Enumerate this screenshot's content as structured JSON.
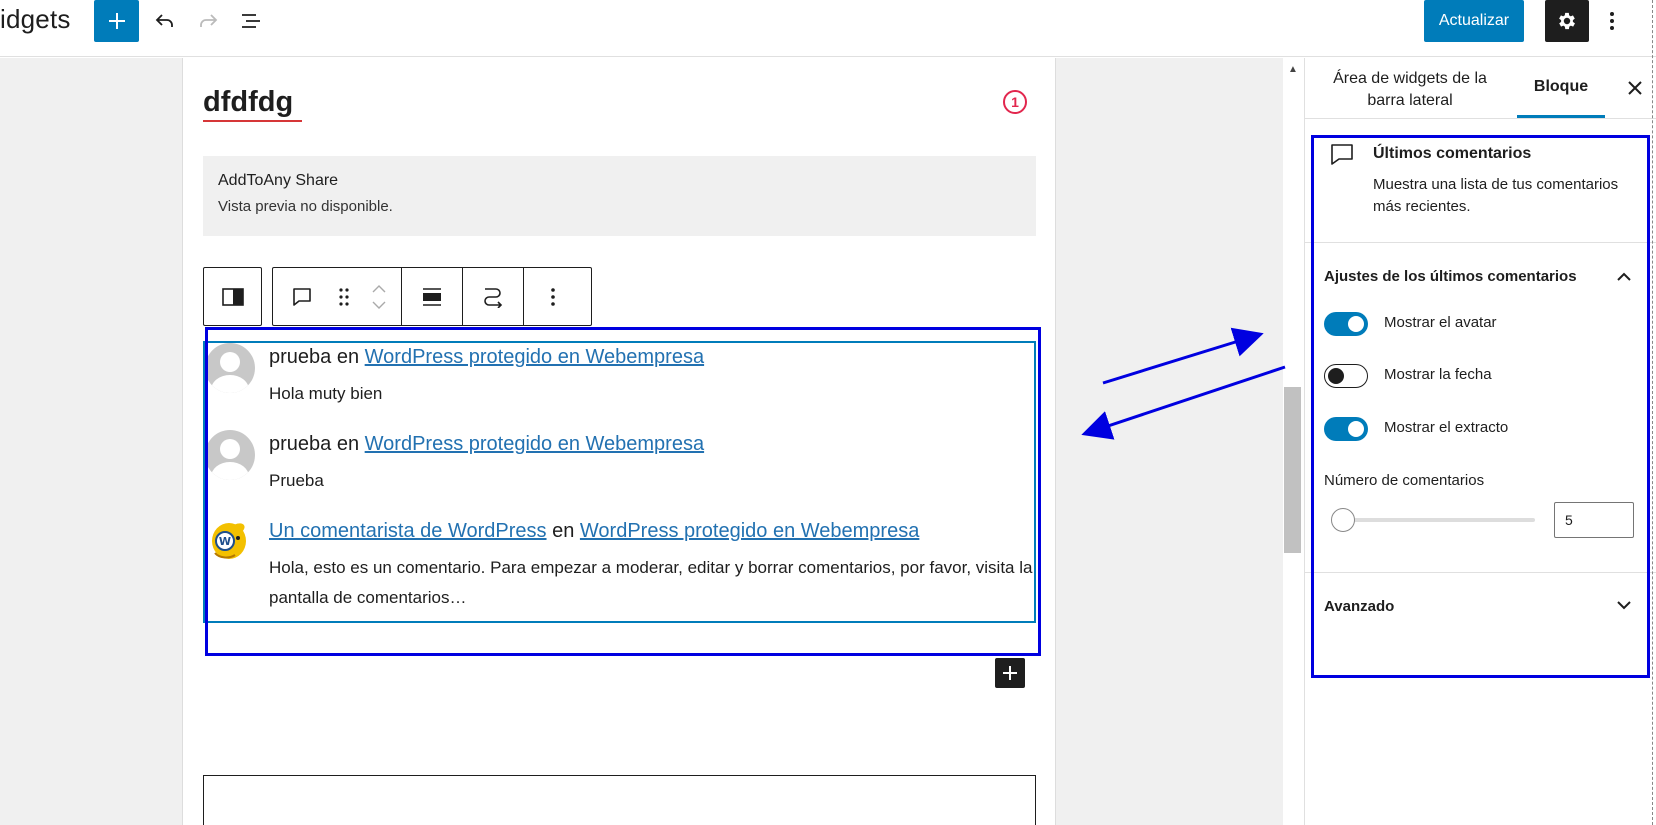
{
  "header": {
    "app_title": "idgets",
    "update_label": "Actualizar"
  },
  "editor": {
    "area_title": "dfdfdg",
    "error_count": "1",
    "share_block": {
      "title": "AddToAny Share",
      "subtitle": "Vista previa no disponible."
    },
    "comments": [
      {
        "author": "prueba",
        "connector": "en",
        "post": "WordPress protegido en Webempresa",
        "excerpt": "Hola muty bien",
        "author_is_link": false
      },
      {
        "author": "prueba",
        "connector": "en",
        "post": "WordPress protegido en Webempresa",
        "excerpt": "Prueba",
        "author_is_link": false
      },
      {
        "author": "Un comentarista de WordPress",
        "connector": "en",
        "post": "WordPress protegido en Webempresa",
        "excerpt": "Hola, esto es un comentario. Para empezar a moderar, editar y borrar comentarios, por favor, visita la pantalla de comentarios…",
        "author_is_link": true
      }
    ]
  },
  "sidebar": {
    "tab_widgets": "Área de widgets de la barra lateral",
    "tab_block": "Bloque",
    "block_name": "Últimos comentarios",
    "block_desc": "Muestra una lista de tus comentarios más recientes.",
    "settings_title": "Ajustes de los últimos comentarios",
    "toggles": [
      {
        "label": "Mostrar el avatar",
        "on": true
      },
      {
        "label": "Mostrar la fecha",
        "on": false
      },
      {
        "label": "Mostrar el extracto",
        "on": true
      }
    ],
    "number_label": "Número de comentarios",
    "number_value": "5",
    "advanced_title": "Avanzado"
  },
  "colors": {
    "accent": "#007cba",
    "link": "#2271b1",
    "annotation": "#0000e0",
    "error": "#e2264d"
  }
}
